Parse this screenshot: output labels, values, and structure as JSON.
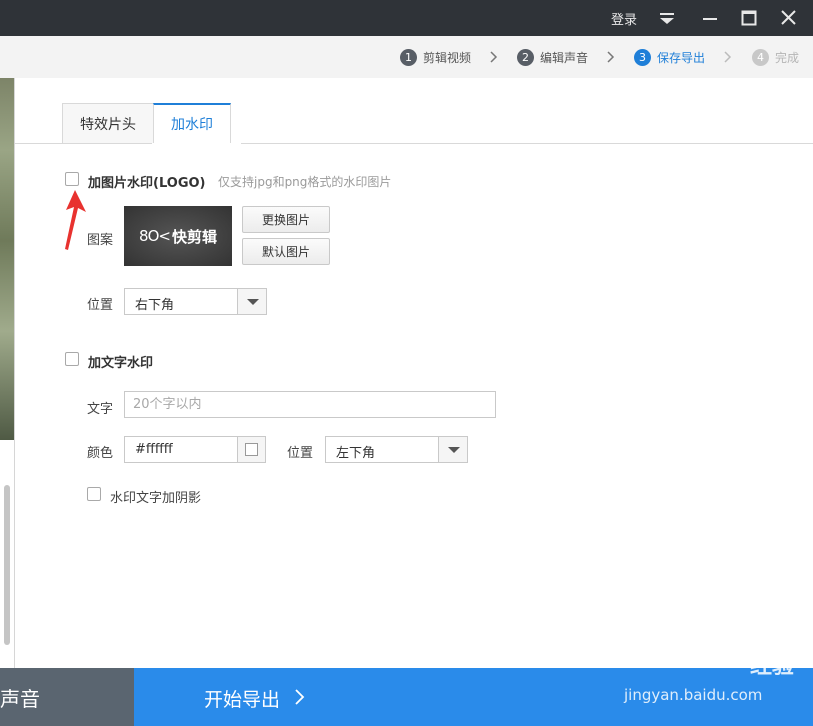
{
  "titlebar": {
    "login_label": "登录",
    "icons": [
      "menu-dropdown-icon",
      "minimize-icon",
      "maximize-icon",
      "close-icon"
    ]
  },
  "steps": [
    {
      "num": "1",
      "label": "剪辑视频",
      "state": "done"
    },
    {
      "num": "2",
      "label": "编辑声音",
      "state": "done"
    },
    {
      "num": "3",
      "label": "保存导出",
      "state": "active"
    },
    {
      "num": "4",
      "label": "完成",
      "state": "disabled"
    }
  ],
  "tabs": [
    {
      "label": "特效片头",
      "active": false
    },
    {
      "label": "加水印",
      "active": true
    }
  ],
  "image_watermark": {
    "checkbox_label": "加图片水印(LOGO)",
    "checked": false,
    "hint": "仅支持jpg和png格式的水印图片",
    "pattern_label": "图案",
    "logo_text": "快剪辑",
    "logo_symbol": "8O<",
    "replace_button": "更换图片",
    "default_button": "默认图片",
    "position_label": "位置",
    "position_value": "右下角"
  },
  "text_watermark": {
    "checkbox_label": "加文字水印",
    "checked": false,
    "text_label": "文字",
    "text_placeholder": "20个字以内",
    "color_label": "颜色",
    "color_value": "#ffffff",
    "position_label": "位置",
    "position_value": "左下角",
    "shadow_label": "水印文字加阴影",
    "shadow_checked": false
  },
  "bottom": {
    "left_label": "辑声音",
    "export_label": "开始导出"
  },
  "watermark": {
    "brand": "Baidu",
    "brand2": "经验",
    "url": "jingyan.baidu.com"
  },
  "colors": {
    "titlebar_bg": "#2f3338",
    "accent": "#1f7fd8",
    "export_button": "#2a8bea",
    "bottom_left_bg": "#5a6570",
    "annotation_arrow": "#e8322f"
  }
}
